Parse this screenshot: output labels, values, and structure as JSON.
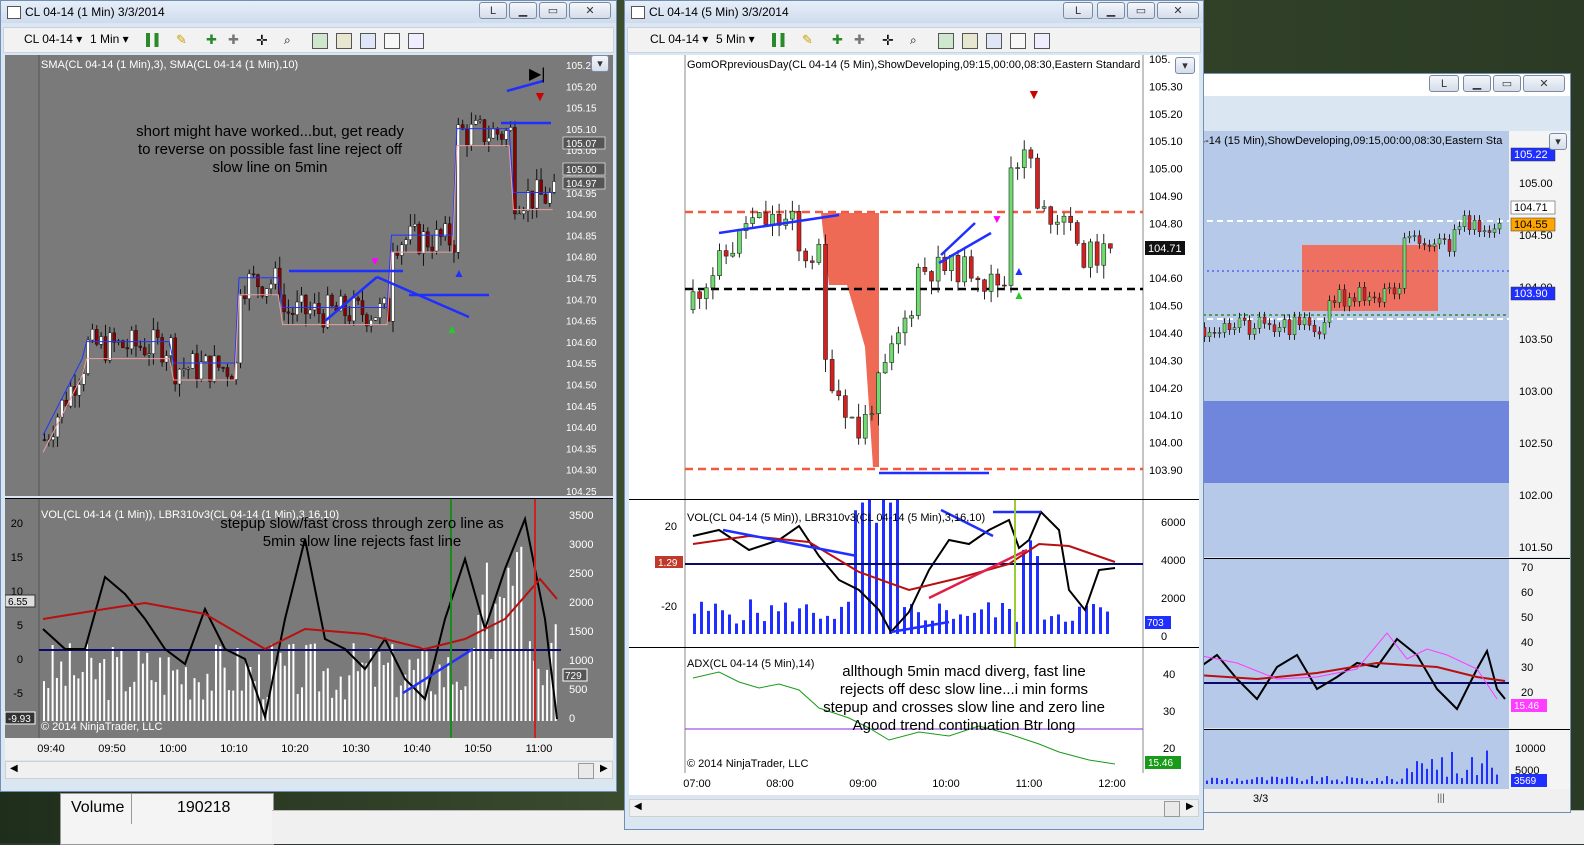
{
  "win1": {
    "title": "CL 04-14 (1 Min)  3/3/2014",
    "btn_l": "L",
    "instrument": "CL 04-14",
    "period": "1 Min",
    "price_indicator": "SMA(CL 04-14 (1 Min),3), SMA(CL 04-14 (1 Min),10)",
    "price_ticks": [
      "105.2",
      "105.20",
      "105.15",
      "105.10",
      "105.05",
      "105.00",
      "104.95",
      "104.90",
      "104.85",
      "104.80",
      "104.75",
      "104.70",
      "104.65",
      "104.60",
      "104.55",
      "104.50",
      "104.45",
      "104.40",
      "104.35",
      "104.30",
      "104.25"
    ],
    "price_flags": [
      "105.07",
      "105.00",
      "104.97"
    ],
    "annotation_price": "short might have worked...but, get ready to reverse on possible fast line reject off slow line on 5min",
    "vol_indicator": "VOL(CL 04-14 (1 Min)), LBR310v3(CL 04-14 (1 Min),3,16,10)",
    "annotation_vol": "stepup slow/fast cross through zero line as 5min slow line rejects fast line",
    "osc_ticks": [
      "20",
      "15",
      "10",
      "5",
      "0",
      "-5"
    ],
    "osc_flag": "6.55",
    "osc_flag2": "-9.93",
    "vol_ticks": [
      "3500",
      "3000",
      "2500",
      "2000",
      "1500",
      "1000",
      "500",
      "0"
    ],
    "vol_flag": "729",
    "copyright": "© 2014 NinjaTrader, LLC",
    "time_ticks": [
      "09:40",
      "09:50",
      "10:00",
      "10:10",
      "10:20",
      "10:30",
      "10:40",
      "10:50",
      "11:00"
    ]
  },
  "win2": {
    "title": "CL 04-14 (5 Min)  3/3/2014",
    "btn_l": "L",
    "instrument": "CL 04-14",
    "period": "5 Min",
    "price_indicator": "GomORpreviousDay(CL 04-14 (5 Min),ShowDeveloping,09:15,00:00,08:30,Eastern Standard",
    "price_ticks": [
      "105.",
      "105.30",
      "105.20",
      "105.10",
      "105.00",
      "104.90",
      "104.80",
      "104.70",
      "104.60",
      "104.50",
      "104.40",
      "104.30",
      "104.20",
      "104.10",
      "104.00",
      "103.90"
    ],
    "price_flag": "104.71",
    "vol_indicator": "VOL(CL 04-14 (5 Min)), LBR310v3(CL 04-14 (5 Min),3,16,10)",
    "osc_ticks": [
      "20",
      "",
      "-20"
    ],
    "osc_flag": "1.29",
    "vol_ticks": [
      "6000",
      "4000",
      "2000",
      "0"
    ],
    "vol_flag": "703",
    "adx_indicator": "ADX(CL 04-14 (5 Min),14)",
    "adx_ticks": [
      "40",
      "30",
      "20"
    ],
    "adx_flag": "15.46",
    "annotation_adx": "allthough 5min macd diverg, fast line rejects off desc slow line...i min forms stepup and crosses slow line and zero line Agood trend  continuation Btr long",
    "copyright": "© 2014 NinjaTrader, LLC",
    "time_ticks": [
      "07:00",
      "08:00",
      "09:00",
      "10:00",
      "11:00",
      "12:00"
    ]
  },
  "win3": {
    "btn_l": "L",
    "price_indicator": "4-14 (15 Min),ShowDeveloping,09:15,00:00,08:30,Eastern Sta",
    "price_ticks": [
      "105.00",
      "104.50",
      "104.00",
      "103.50",
      "103.00",
      "102.50",
      "102.00",
      "101.50"
    ],
    "price_flags": [
      "105.22",
      "104.71",
      "104.55",
      "103.90"
    ],
    "osc_ticks": [
      "70",
      "60",
      "50",
      "40",
      "30",
      "20"
    ],
    "osc_flag": "15.46",
    "vol_ticks": [
      "10000",
      "5000"
    ],
    "vol_flag": "3569",
    "date_tick": "3/3"
  },
  "status": {
    "label": "Volume",
    "value": "190218"
  }
}
